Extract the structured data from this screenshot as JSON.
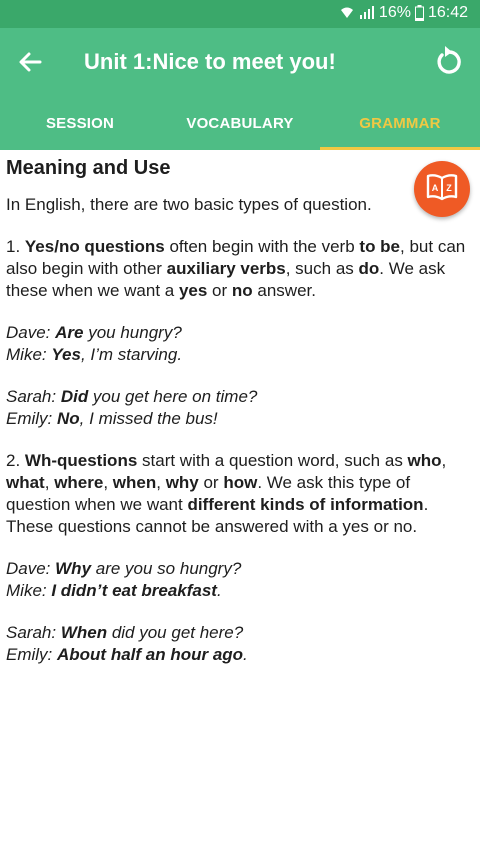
{
  "status_bar": {
    "battery": "16%",
    "time": "16:42"
  },
  "app_bar": {
    "title": "Unit 1:Nice to meet you!"
  },
  "tabs": [
    {
      "label": "SESSION"
    },
    {
      "label": "VOCABULARY"
    },
    {
      "label": "GRAMMAR",
      "active": true
    }
  ],
  "content": {
    "heading": "Meaning and Use",
    "intro": "In English, there are two basic types of question.",
    "p1": {
      "prefix": "1. ",
      "b1": "Yes/no questions",
      "t1": " often begin with the verb ",
      "b2": "to be",
      "t2": ", but can also begin with other ",
      "b3": "auxiliary verbs",
      "t3": ", such as ",
      "b4": "do",
      "t4": ". We ask these when we want a ",
      "b5": "yes",
      "t5": " or ",
      "b6": "no",
      "t6": " answer."
    },
    "d1": [
      {
        "speaker": "Dave: ",
        "bold": "Are",
        "rest": " you hungry?"
      },
      {
        "speaker": "Mike: ",
        "bold": "Yes",
        "rest": ", I’m starving."
      }
    ],
    "d2": [
      {
        "speaker": "Sarah: ",
        "bold": "Did",
        "rest": " you get here on time?"
      },
      {
        "speaker": "Emily: ",
        "bold": "No",
        "rest": ", I missed the bus!"
      }
    ],
    "p2": {
      "prefix": "2. ",
      "b1": "Wh-questions",
      "t1": " start with a question word, such as ",
      "b2": "who",
      "t2": ", ",
      "b3": "what",
      "t3": ", ",
      "b4": "where",
      "t4": ", ",
      "b5": "when",
      "t5": ", ",
      "b6": "why",
      "t6": " or ",
      "b7": "how",
      "t7": ". We ask this type of question when we want ",
      "b8": "different kinds of information",
      "t8": ". These questions cannot be answered with a yes or no."
    },
    "d3": [
      {
        "speaker": "Dave: ",
        "bold": "Why",
        "rest": " are you so hungry?"
      },
      {
        "speaker": "Mike: ",
        "bold": "I didn’t eat breakfast",
        "rest": "."
      }
    ],
    "d4": [
      {
        "speaker": "Sarah: ",
        "bold": "When",
        "rest": " did you get here?"
      },
      {
        "speaker": "Emily: ",
        "bold": "About half an hour ago",
        "rest": "."
      }
    ]
  },
  "fab": {
    "icon": "dictionary-book-icon",
    "letters": [
      "A",
      "Z"
    ]
  },
  "colors": {
    "status_bar": "#3aa86a",
    "app_bar": "#4ebd85",
    "tab_active": "#f0c843",
    "fab": "#ef5a25"
  }
}
